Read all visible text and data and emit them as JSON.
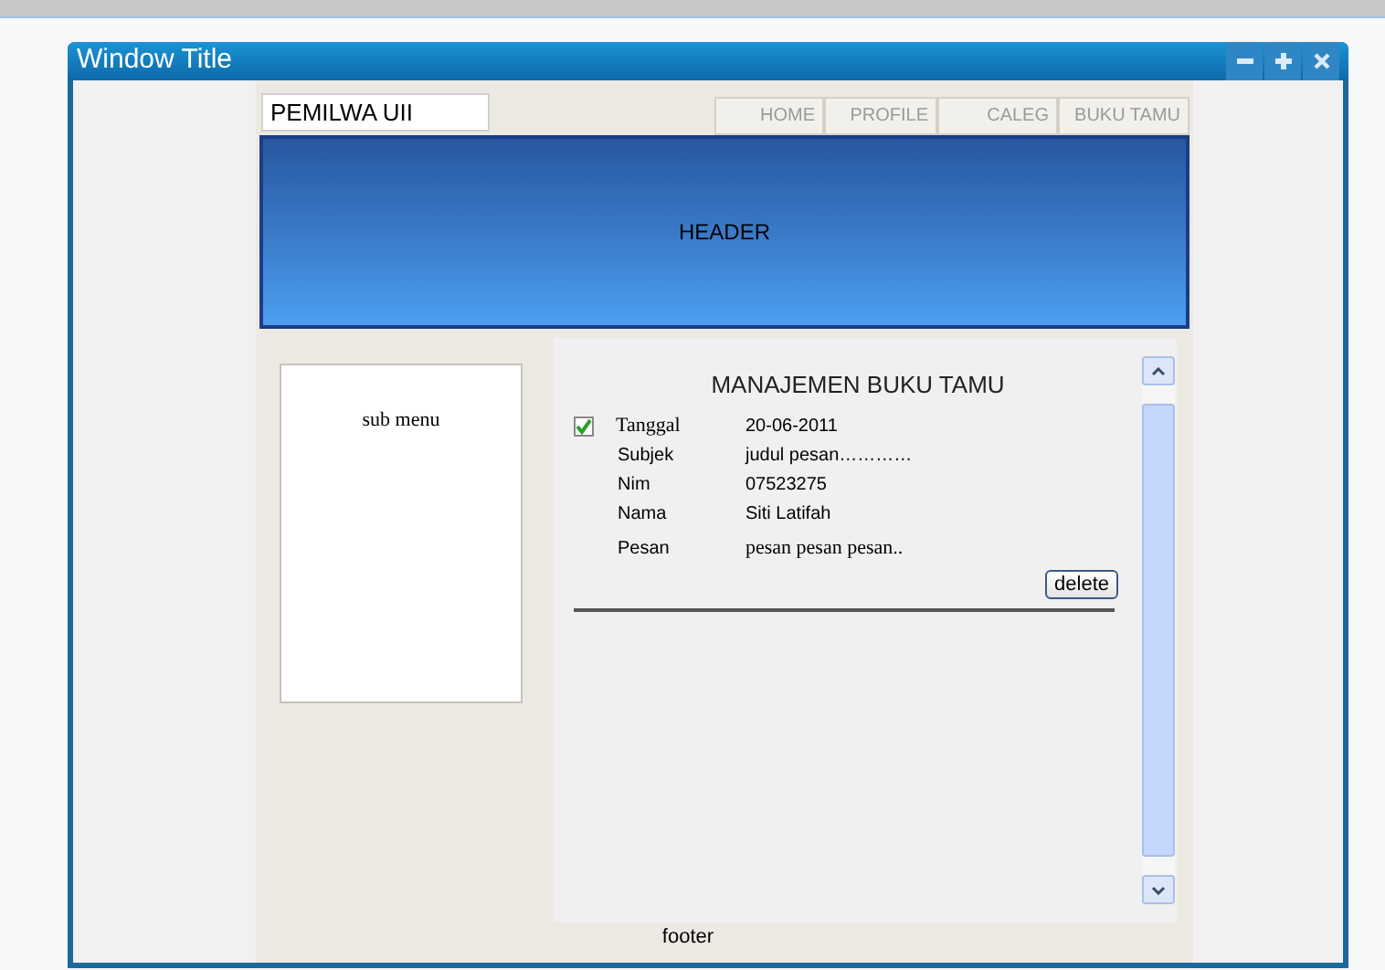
{
  "window": {
    "title": "Window Title"
  },
  "site": {
    "logo": "PEMILWA UII",
    "nav": [
      {
        "label": "HOME",
        "selected": false
      },
      {
        "label": "PROFILE",
        "selected": false
      },
      {
        "label": "CALEG",
        "selected": false
      },
      {
        "label": "BUKU TAMU",
        "selected": false
      }
    ],
    "header": "HEADER",
    "sub_menu": "sub menu",
    "footer": "footer"
  },
  "guestbook": {
    "title": "MANAJEMEN BUKU TAMU",
    "checked": true,
    "fields": [
      {
        "label": "Tanggal",
        "value": "20-06-2011"
      },
      {
        "label": "Subjek",
        "value": "judul pesan…………"
      },
      {
        "label": "Nim",
        "value": "07523275"
      },
      {
        "label": "Nama",
        "value": "Siti Latifah"
      },
      {
        "label": "Pesan",
        "value": "pesan pesan pesan.."
      }
    ],
    "button": "delete"
  }
}
